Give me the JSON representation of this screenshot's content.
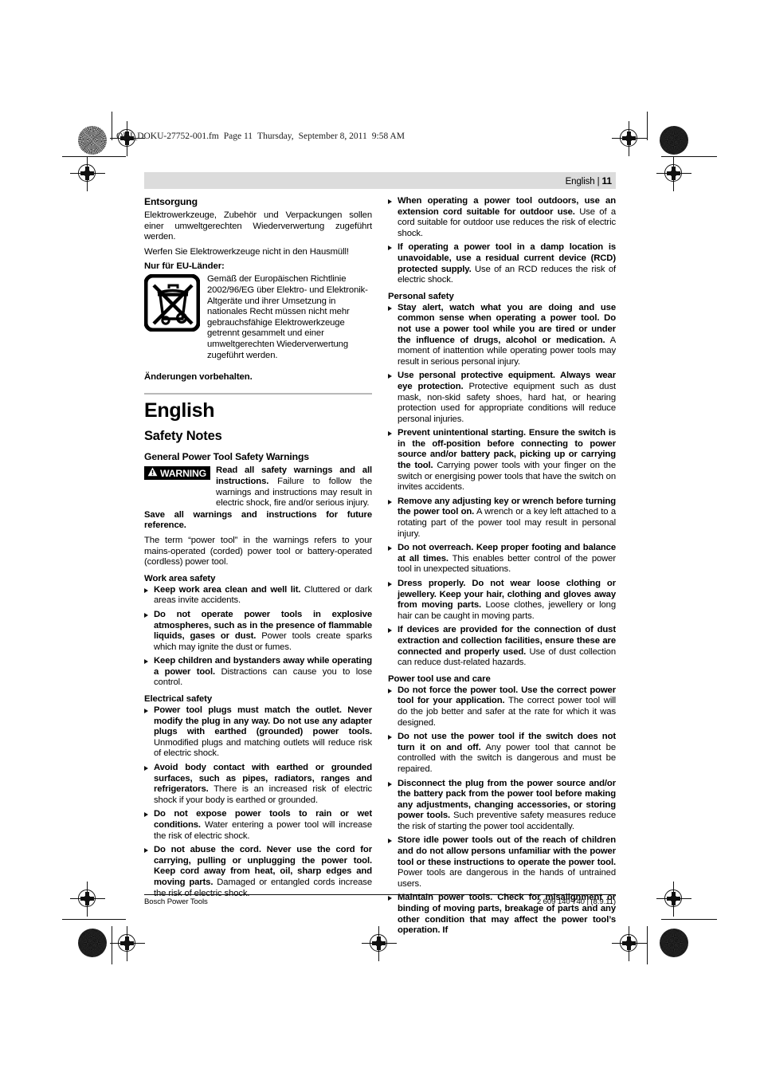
{
  "print_marks": {
    "file_stamp": {
      "filename": "OBJ_DOKU-27752-001.fm",
      "page_label": "Page 11",
      "weekday": "Thursday,",
      "date": "September 8, 2011",
      "time": "9:58 AM"
    }
  },
  "running_head": {
    "language": "English",
    "separator": "|",
    "page_number": "11"
  },
  "footer": {
    "left": "Bosch Power Tools",
    "right": "2 609 140 740 | (8.9.11)"
  },
  "left_column": {
    "entsorgung": {
      "heading": "Entsorgung",
      "paragraph_1": "Elektrowerkzeuge, Zubehör und Verpackungen sollen einer umweltgerechten Wiederverwertung zugeführt werden.",
      "paragraph_2": "Werfen Sie Elektrowerkzeuge nicht in den Hausmüll!",
      "eu_heading": "Nur für EU-Länder:",
      "weee_icon_name": "crossed-out-wheelie-bin-icon",
      "eu_text": "Gemäß der Europäischen Richtlinie 2002/96/EG über Elektro- und Elektronik-Altgeräte und ihrer Umsetzung in nationales Recht müssen nicht mehr gebrauchsfähige Elektrowerkzeuge getrennt gesammelt und einer umweltgerechten Wiederverwertung zugeführt werden.",
      "reservation": "Änderungen vorbehalten."
    },
    "english_section": {
      "language_heading": "English",
      "safety_notes_heading": "Safety Notes",
      "general_heading": "General Power Tool Safety Warnings",
      "warning_badge_label": "WARNING",
      "warning_badge_icon": "warning-triangle-icon",
      "warning_lead_bold": "Read all safety warnings and all instructions.",
      "warning_lead_rest": " Failure to follow the warnings and instructions may result in electric shock, fire and/or serious injury.",
      "save_bold": "Save all warnings and instructions for future reference.",
      "save_rest": "The term “power tool” in the warnings refers to your mains-operated (corded) power tool or battery-operated (cordless) power tool.",
      "work_area_heading": "Work area safety",
      "work_area_items": [
        {
          "bold": "Keep work area clean and well lit.",
          "rest": " Cluttered or dark areas invite accidents."
        },
        {
          "bold": "Do not operate power tools in explosive atmospheres, such as in the presence of flammable liquids, gases or dust.",
          "rest": " Power tools create sparks which may ignite the dust or fumes."
        },
        {
          "bold": "Keep children and bystanders away while operating a power tool.",
          "rest": " Distractions can cause you to lose control."
        }
      ],
      "electrical_heading": "Electrical safety",
      "electrical_items": [
        {
          "bold": "Power tool plugs must match the outlet. Never modify the plug in any way. Do not use any adapter plugs with earthed (grounded) power tools.",
          "rest": " Unmodified plugs and matching outlets will reduce risk of electric shock."
        },
        {
          "bold": "Avoid body contact with earthed or grounded surfaces, such as pipes, radiators, ranges and refrigerators.",
          "rest": " There is an increased risk of electric shock if your body is earthed or grounded."
        },
        {
          "bold": "Do not expose power tools to rain or wet conditions.",
          "rest": " Water entering a power tool will increase the risk of electric shock."
        },
        {
          "bold": "Do not abuse the cord. Never use the cord for carrying, pulling or unplugging the power tool. Keep cord away from heat, oil, sharp edges and moving parts.",
          "rest": " Damaged or entangled cords increase the risk of electric shock."
        }
      ]
    }
  },
  "right_column": {
    "electrical_continued": [
      {
        "bold": "When operating a power tool outdoors, use an extension cord suitable for outdoor use.",
        "rest": " Use of a cord suitable for outdoor use reduces the risk of electric shock."
      },
      {
        "bold": "If operating a power tool in a damp location is unavoidable, use a residual current device (RCD) protected supply.",
        "rest": " Use of an RCD reduces the risk of electric shock."
      }
    ],
    "personal_safety_heading": "Personal safety",
    "personal_safety_items": [
      {
        "bold": "Stay alert, watch what you are doing and use common sense when operating a power tool. Do not use a power tool while you are tired or under the influence of drugs, alcohol or medication.",
        "rest": " A moment of inattention while operating power tools may result in serious personal injury."
      },
      {
        "bold": "Use personal protective equipment. Always wear eye protection.",
        "rest": " Protective equipment such as dust mask, non-skid safety shoes, hard hat, or hearing protection used for appropriate conditions will reduce personal injuries."
      },
      {
        "bold": "Prevent unintentional starting. Ensure the switch is in the off-position before connecting to power source and/or battery pack, picking up or carrying the tool.",
        "rest": " Carrying power tools with your finger on the switch or energising power tools that have the switch on invites accidents."
      },
      {
        "bold": "Remove any adjusting key or wrench before turning the power tool on.",
        "rest": " A wrench or a key left attached to a rotating part of the power tool may result in personal injury."
      },
      {
        "bold": "Do not overreach. Keep proper footing and balance at all times.",
        "rest": " This enables better control of the power tool in unexpected situations."
      },
      {
        "bold": "Dress properly. Do not wear loose clothing or jewellery. Keep your hair, clothing and gloves away from moving parts.",
        "rest": " Loose clothes, jewellery or long hair can be caught in moving parts."
      },
      {
        "bold": "If devices are provided for the connection of dust extraction and collection facilities, ensure these are connected and properly used.",
        "rest": " Use of dust collection can reduce dust-related hazards."
      }
    ],
    "use_care_heading": "Power tool use and care",
    "use_care_items": [
      {
        "bold": "Do not force the power tool. Use the correct power tool for your application.",
        "rest": " The correct power tool will do the job better and safer at the rate for which it was designed."
      },
      {
        "bold": "Do not use the power tool if the switch does not turn it on and off.",
        "rest": " Any power tool that cannot be controlled with the switch is dangerous and must be repaired."
      },
      {
        "bold": "Disconnect the plug from the power source and/or the battery pack from the power tool before making any adjustments, changing accessories, or storing power tools.",
        "rest": " Such preventive safety measures reduce the risk of starting the power tool accidentally."
      },
      {
        "bold": "Store idle power tools out of the reach of children and do not allow persons unfamiliar with the power tool or these instructions to operate the power tool.",
        "rest": " Power tools are dangerous in the hands of untrained users."
      },
      {
        "bold": "Maintain power tools. Check for misalignment or binding of moving parts, breakage of parts and any other condition that may affect the power tool’s operation. If",
        "rest": ""
      }
    ]
  }
}
